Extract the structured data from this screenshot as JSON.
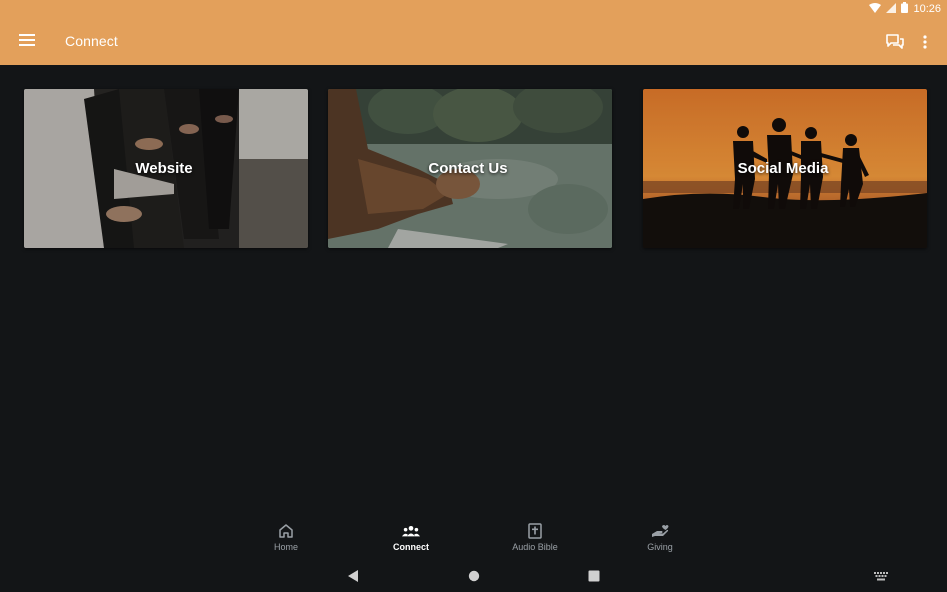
{
  "status_bar": {
    "time": "10:26"
  },
  "app_bar": {
    "title": "Connect"
  },
  "cards": [
    {
      "label": "Website"
    },
    {
      "label": "Contact Us"
    },
    {
      "label": "Social Media"
    }
  ],
  "bottom_nav": {
    "items": [
      {
        "label": "Home",
        "icon": "home-icon"
      },
      {
        "label": "Connect",
        "icon": "people-icon",
        "active": true
      },
      {
        "label": "Audio Bible",
        "icon": "bible-icon"
      },
      {
        "label": "Giving",
        "icon": "giving-hand-icon"
      }
    ]
  },
  "colors": {
    "accent": "#e3a05b",
    "background": "#131517",
    "nav_inactive": "#9aa0a6"
  }
}
